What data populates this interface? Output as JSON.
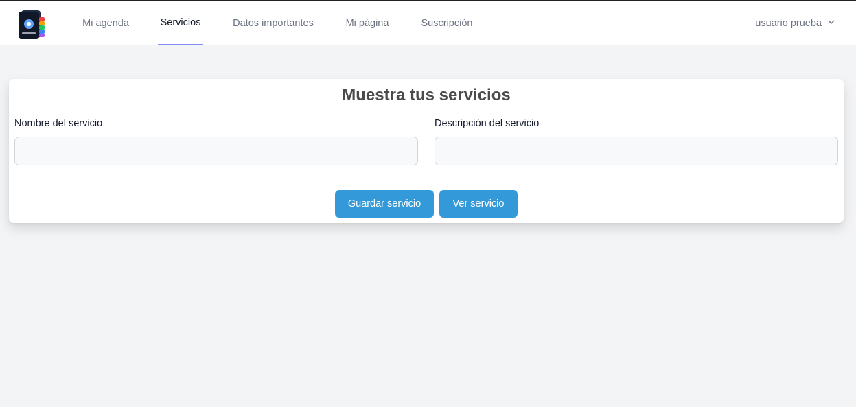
{
  "nav": {
    "items": [
      {
        "label": "Mi agenda"
      },
      {
        "label": "Servicios",
        "active": true
      },
      {
        "label": "Datos importantes"
      },
      {
        "label": "Mi página"
      },
      {
        "label": "Suscripción"
      }
    ],
    "user_label": "usuario prueba"
  },
  "form": {
    "title": "Muestra tus servicios",
    "name_label": "Nombre del servicio",
    "name_value": "",
    "description_label": "Descripción del servicio",
    "description_value": "",
    "save_button": "Guardar servicio",
    "view_button": "Ver servicio"
  },
  "colors": {
    "accent_button": "#3399d8",
    "active_tab_underline": "#818cf8",
    "page_background": "#f3f4f6"
  },
  "icons": {
    "logo": "wallet-logo-icon",
    "user_menu": "chevron-down-icon"
  }
}
